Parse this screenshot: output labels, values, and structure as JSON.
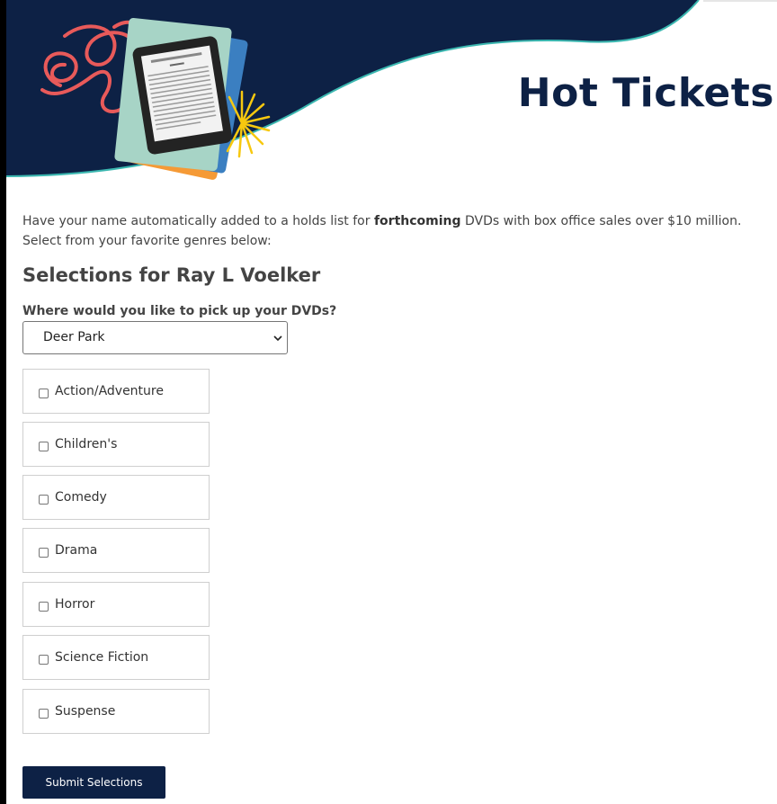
{
  "header": {
    "title": "Hot Tickets"
  },
  "intro": {
    "before": "Have your name automatically added to a holds list for ",
    "emphasis": "forthcoming",
    "after": " DVDs with box office sales over $10 million. Select from your favorite genres below:"
  },
  "section": {
    "title": "Selections for Ray L Voelker"
  },
  "pickup": {
    "label": "Where would you like to pick up your DVDs?",
    "selected": "Deer Park"
  },
  "genres": [
    {
      "label": "Action/Adventure",
      "checked": false
    },
    {
      "label": "Children's",
      "checked": false
    },
    {
      "label": "Comedy",
      "checked": false
    },
    {
      "label": "Drama",
      "checked": false
    },
    {
      "label": "Horror",
      "checked": false
    },
    {
      "label": "Science Fiction",
      "checked": false
    },
    {
      "label": "Suspense",
      "checked": false
    }
  ],
  "submit": {
    "label": "Submit Selections"
  },
  "colors": {
    "navy": "#0d2145",
    "teal": "#3bb7b0",
    "coral": "#e85a5a",
    "yellow": "#f7c80f"
  }
}
